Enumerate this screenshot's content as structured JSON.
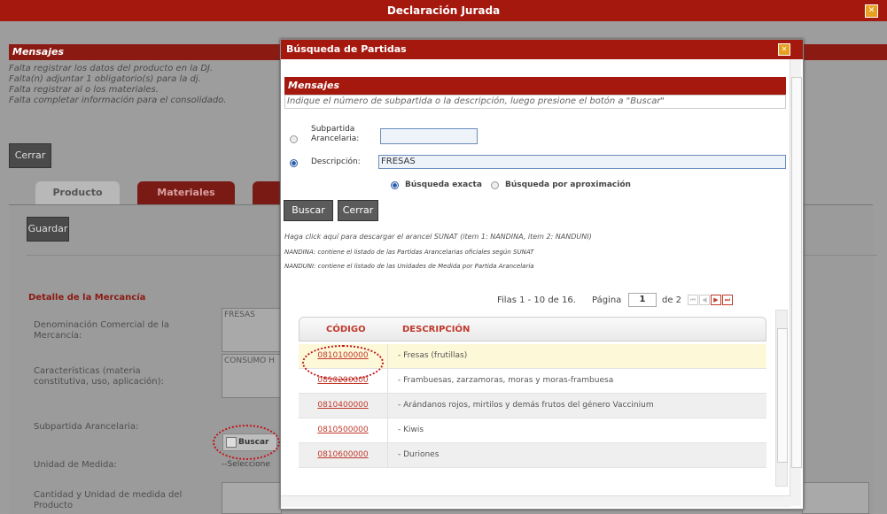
{
  "main": {
    "title": "Declaración Jurada",
    "messages_title": "Mensajes",
    "messages": [
      "Falta registrar los datos del producto en la DJ.",
      "Falta(n) adjuntar 1 obligatorio(s) para la dj.",
      "Falta registrar al o los materiales.",
      "Falta completar información para el consolidado."
    ],
    "cerrar_label": "Cerrar",
    "tabs": [
      "Producto",
      "Materiales"
    ],
    "guardar_label": "Guardar",
    "section_title": "Detalle de la Mercancía",
    "fields": {
      "denominacion_label": "Denominación Comercial de la Mercancía:",
      "denominacion_value": "FRESAS",
      "caracteristicas_label": "Características (materia constitutiva, uso, aplicación):",
      "caracteristicas_value": "CONSUMO H",
      "subpartida_label": "Subpartida Arancelaria:",
      "buscar_label": "Buscar",
      "unidad_label": "Unidad de Medida:",
      "unidad_value": "--Seleccione",
      "cantidad_label": "Cantidad y Unidad de medida del Producto"
    }
  },
  "modal": {
    "title": "Búsqueda de Partidas",
    "messages_title": "Mensajes",
    "instruction": "Indique el número de subpartida o la descripción, luego presione el botón a \"Buscar\"",
    "subpartida_label": "Subpartida Arancelaria:",
    "subpartida_value": "",
    "descripcion_label": "Descripción:",
    "descripcion_value": "FRESAS",
    "exact_label": "Búsqueda exacta",
    "approx_label": "Búsqueda por aproximación",
    "buscar_label": "Buscar",
    "cerrar_label": "Cerrar",
    "note1": "Haga click aquí para descargar el arancel SUNAT (item 1: NANDINA, item 2: NANDUNI)",
    "note2": "NANDINA: contiene el listado de las Partidas Arancelarias oficiales según SUNAT",
    "note3": "NANDUNI: contiene el listado de las Unidades de Medida por Partida Arancelaria",
    "pager": {
      "rows_text": "Filas 1 - 10 de 16.",
      "page_label": "Página",
      "page_value": "1",
      "of_text": "de 2"
    },
    "columns": [
      "CÓDIGO",
      "DESCRIPCIÓN"
    ],
    "rows": [
      {
        "code": "0810100000",
        "desc": "- Fresas (frutillas)"
      },
      {
        "code": "0810200000",
        "desc": "- Frambuesas, zarzamoras, moras y moras-frambuesa"
      },
      {
        "code": "0810400000",
        "desc": "- Arándanos rojos, mirtilos y demás frutos del género Vaccinium"
      },
      {
        "code": "0810500000",
        "desc": "- Kiwis"
      },
      {
        "code": "0810600000",
        "desc": "- Duriones"
      }
    ]
  },
  "colors": {
    "title_bar": "#a5180e",
    "highlight_row": "#fdf8d8",
    "alt_row": "#efefef",
    "annotation": "#c0161b"
  }
}
